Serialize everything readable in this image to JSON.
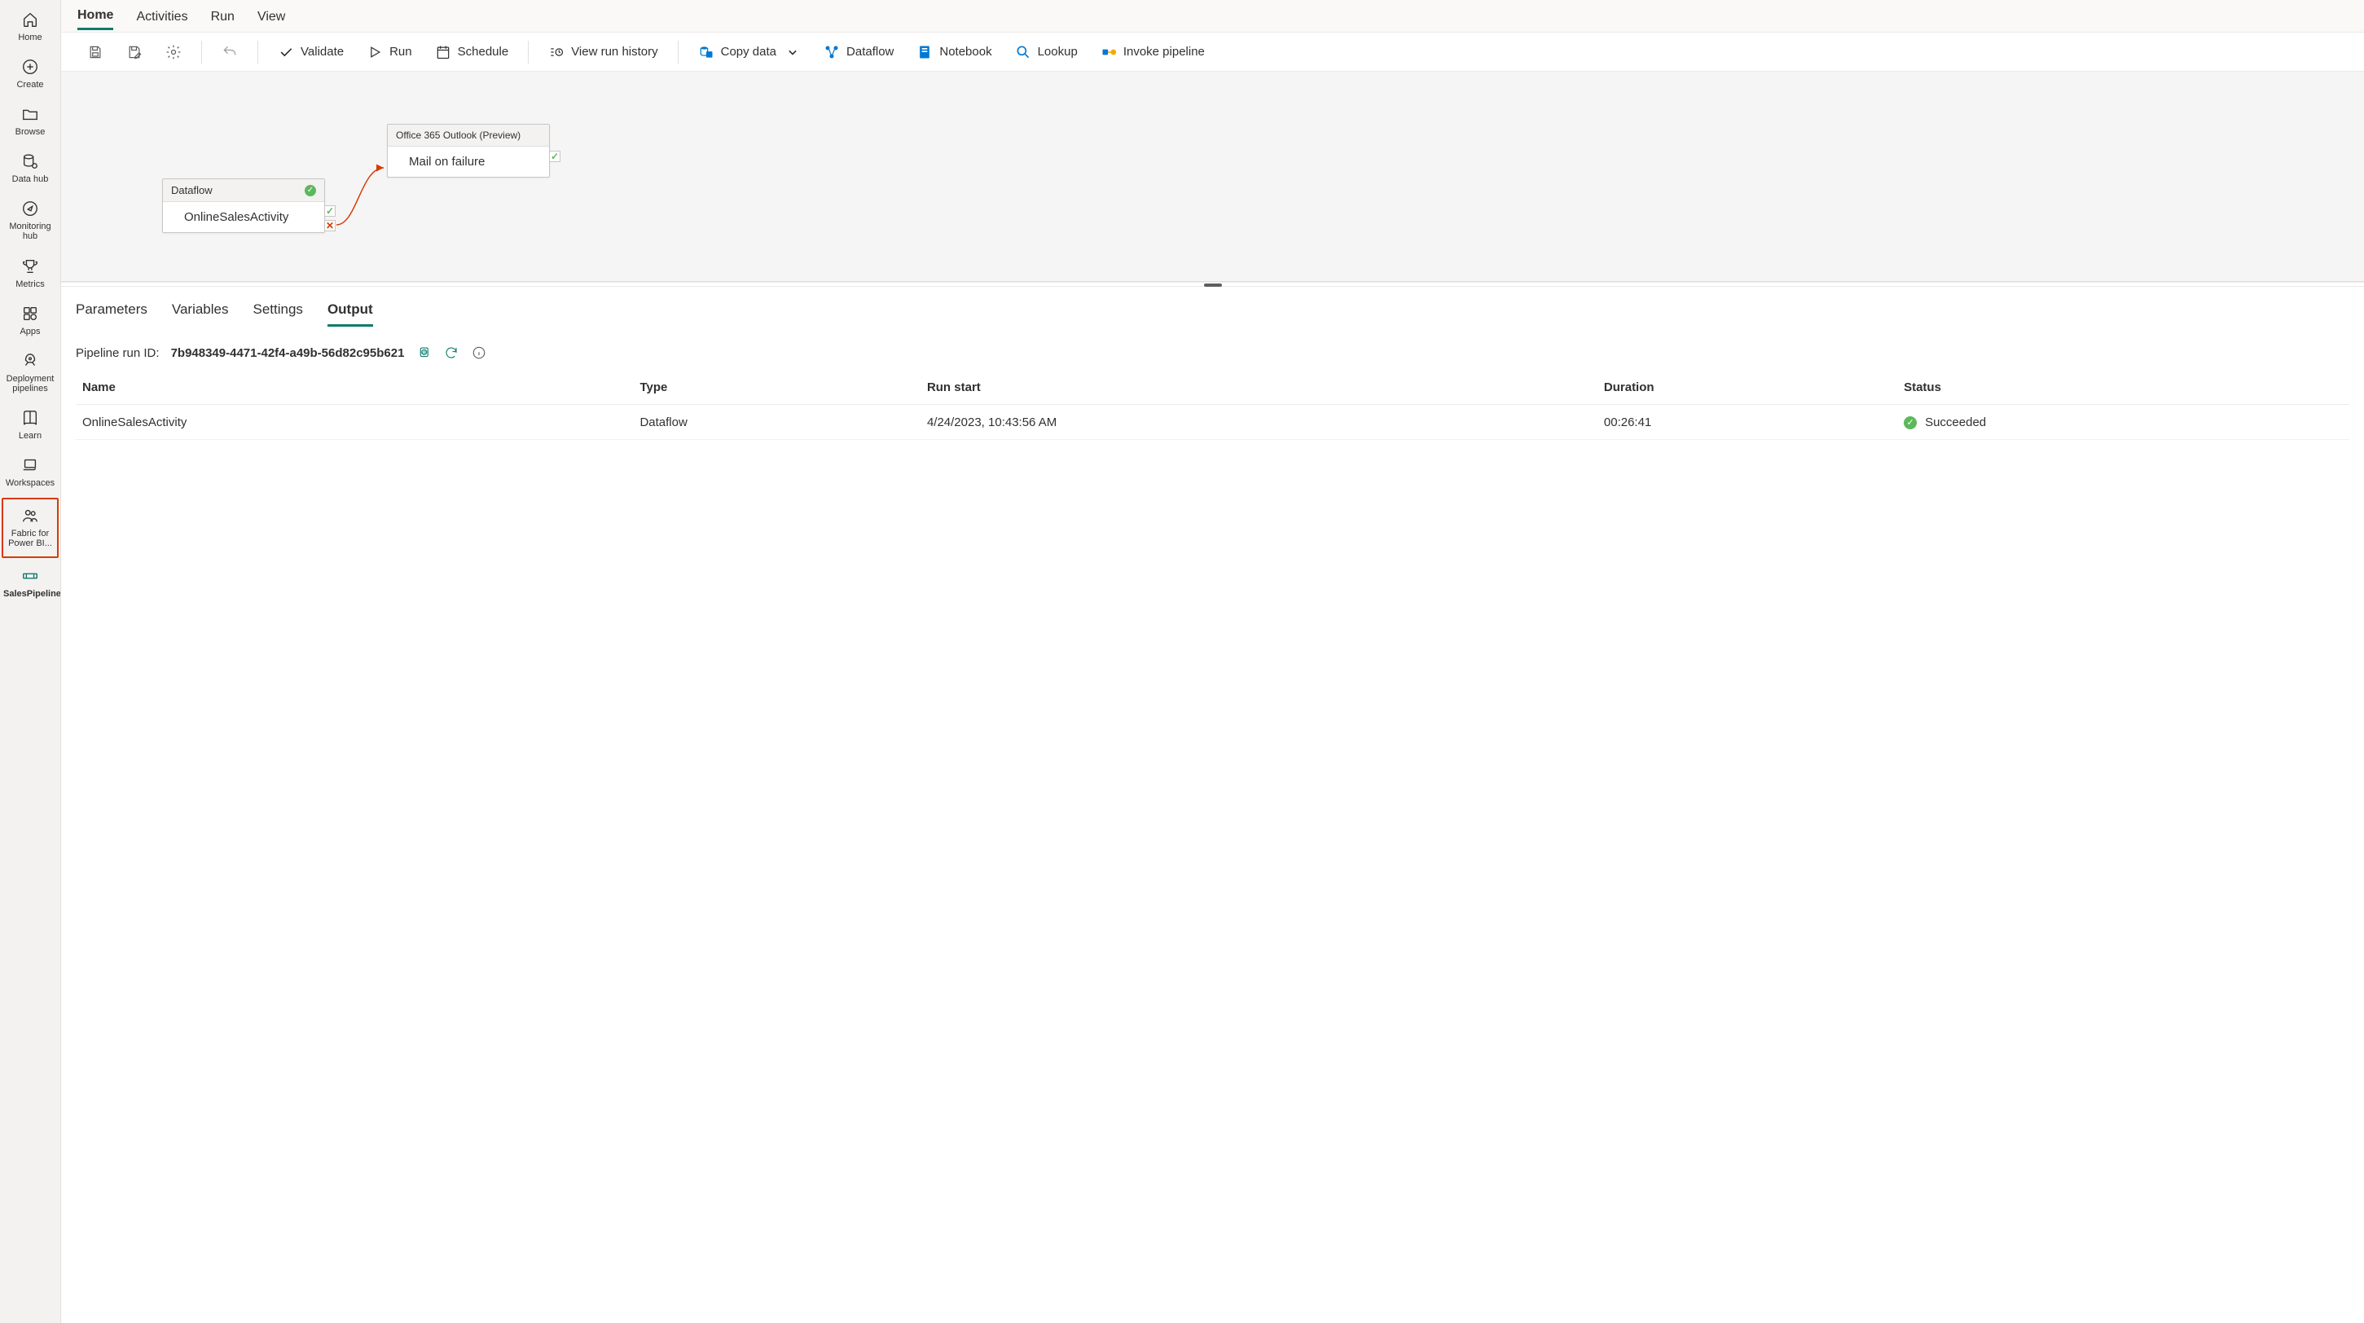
{
  "leftnav": [
    {
      "icon": "home",
      "label": "Home"
    },
    {
      "icon": "plus-circle",
      "label": "Create"
    },
    {
      "icon": "folder",
      "label": "Browse"
    },
    {
      "icon": "db",
      "label": "Data hub"
    },
    {
      "icon": "compass",
      "label": "Monitoring hub"
    },
    {
      "icon": "trophy",
      "label": "Metrics"
    },
    {
      "icon": "apps",
      "label": "Apps"
    },
    {
      "icon": "rocket",
      "label": "Deployment pipelines"
    },
    {
      "icon": "book",
      "label": "Learn"
    },
    {
      "icon": "stacks",
      "label": "Workspaces"
    },
    {
      "icon": "people",
      "label": "Fabric for Power BI...",
      "boxed": true
    },
    {
      "icon": "pipeline",
      "label": "SalesPipeline",
      "active": true
    }
  ],
  "toptabs": [
    {
      "label": "Home",
      "active": true
    },
    {
      "label": "Activities"
    },
    {
      "label": "Run"
    },
    {
      "label": "View"
    }
  ],
  "ribbon": {
    "validate": "Validate",
    "run": "Run",
    "schedule": "Schedule",
    "viewRunHistory": "View run history",
    "copyData": "Copy data",
    "dataflow": "Dataflow",
    "notebook": "Notebook",
    "lookup": "Lookup",
    "invokePipeline": "Invoke pipeline"
  },
  "canvas": {
    "node1": {
      "header": "Dataflow",
      "title": "OnlineSalesActivity"
    },
    "node2": {
      "header": "Office 365 Outlook (Preview)",
      "title": "Mail on failure"
    }
  },
  "panelTabs": [
    {
      "label": "Parameters"
    },
    {
      "label": "Variables"
    },
    {
      "label": "Settings"
    },
    {
      "label": "Output",
      "active": true
    }
  ],
  "run": {
    "label": "Pipeline run ID:",
    "id": "7b948349-4471-42f4-a49b-56d82c95b621"
  },
  "table": {
    "headers": [
      "Name",
      "Type",
      "Run start",
      "Duration",
      "Status"
    ],
    "rows": [
      {
        "name": "OnlineSalesActivity",
        "type": "Dataflow",
        "start": "4/24/2023, 10:43:56 AM",
        "duration": "00:26:41",
        "status": "Succeeded"
      }
    ]
  }
}
